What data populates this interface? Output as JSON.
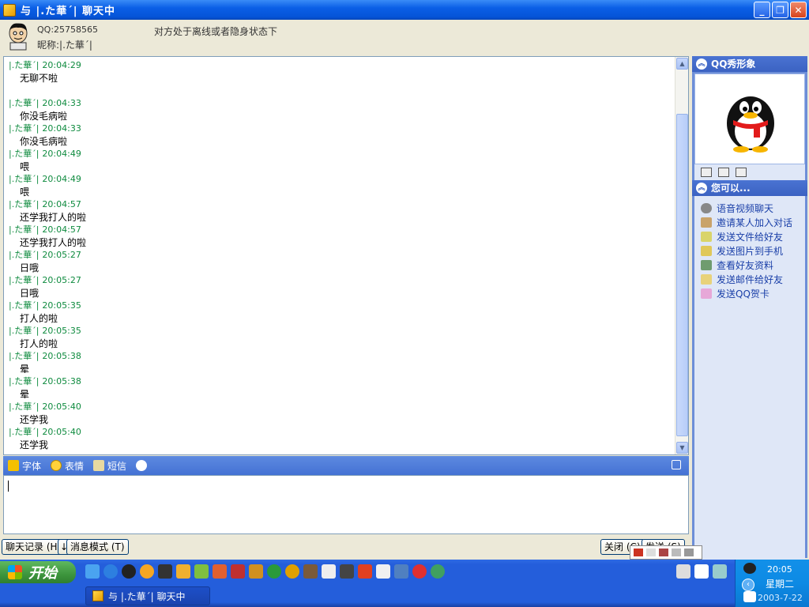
{
  "window": {
    "title": "与 |.た華ˊ| 聊天中",
    "minimize": "_",
    "maximize": "❐",
    "close": "✕"
  },
  "contact": {
    "qq": "QQ:25758565",
    "nickname": "昵称:|.た華ˊ|",
    "status_message": "对方处于离线或者隐身状态下"
  },
  "messages": [
    {
      "name": "|.た華ˊ|",
      "time": "20:04:29",
      "text": "无聊不啦",
      "gap_after": true
    },
    {
      "name": "|.た華ˊ|",
      "time": "20:04:33",
      "text": "你没毛病啦"
    },
    {
      "name": "|.た華ˊ|",
      "time": "20:04:33",
      "text": "你没毛病啦"
    },
    {
      "name": "|.た華ˊ|",
      "time": "20:04:49",
      "text": "喂"
    },
    {
      "name": "|.た華ˊ|",
      "time": "20:04:49",
      "text": "喂"
    },
    {
      "name": "|.た華ˊ|",
      "time": "20:04:57",
      "text": "还学我打人的啦"
    },
    {
      "name": "|.た華ˊ|",
      "time": "20:04:57",
      "text": "还学我打人的啦"
    },
    {
      "name": "|.た華ˊ|",
      "time": "20:05:27",
      "text": "日哦"
    },
    {
      "name": "|.た華ˊ|",
      "time": "20:05:27",
      "text": "日哦"
    },
    {
      "name": "|.た華ˊ|",
      "time": "20:05:35",
      "text": "打人的啦"
    },
    {
      "name": "|.た華ˊ|",
      "time": "20:05:35",
      "text": "打人的啦"
    },
    {
      "name": "|.た華ˊ|",
      "time": "20:05:38",
      "text": "晕"
    },
    {
      "name": "|.た華ˊ|",
      "time": "20:05:38",
      "text": "晕"
    },
    {
      "name": "|.た華ˊ|",
      "time": "20:05:40",
      "text": "还学我"
    },
    {
      "name": "|.た華ˊ|",
      "time": "20:05:40",
      "text": "还学我"
    }
  ],
  "toolbar": {
    "font": "字体",
    "emoticon": "表情",
    "sms": "短信"
  },
  "bottom": {
    "history": "聊天记录 (H)",
    "history_arrow": "↓",
    "message_mode": "消息模式 (T)",
    "close": "关闭 (C)",
    "send": "发送 (S)"
  },
  "right_panel": {
    "show_title": "QQ秀形象",
    "can_do_title": "您可以...",
    "actions": [
      "语音视频聊天",
      "邀请某人加入对话",
      "发送文件给好友",
      "发送图片到手机",
      "查看好友资料",
      "发送邮件给好友",
      "发送QQ贺卡"
    ]
  },
  "taskbar": {
    "start": "开始",
    "task_button": "与 |.た華ˊ| 聊天中",
    "clock": "20:05",
    "day": "星期二",
    "date": "2003-7-22"
  },
  "colors": {
    "name_color": "#0f8b3f",
    "toolbar_bg": "#4a78d6",
    "panel_bg": "#6d8ed8",
    "taskbar_bg": "#245edb"
  }
}
